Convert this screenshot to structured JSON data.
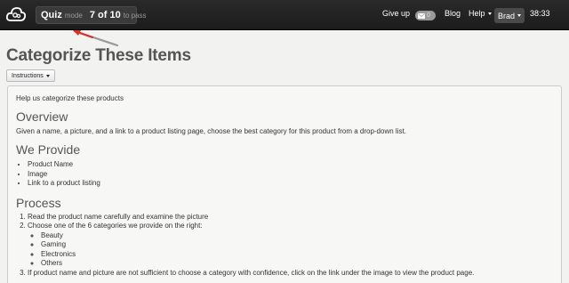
{
  "topbar": {
    "logo_icon": "cloud-logo-icon",
    "mode": {
      "quiz": "Quiz",
      "mode_word": "mode",
      "count": "7 of 10",
      "pass_text": "to pass"
    },
    "give_up": "Give up",
    "mail_icon": "envelope-icon",
    "mail_count": "0",
    "blog": "Blog",
    "help": "Help",
    "user": "Brad",
    "timer": "38:33"
  },
  "annotation": {
    "arrow_color": "#d9312b"
  },
  "main": {
    "title": "Categorize These Items",
    "instructions_button": "Instructions",
    "panel": {
      "intro": "Help us categorize these products",
      "overview_heading": "Overview",
      "overview_text": "Given a name, a picture, and a link to a product listing page, choose the best category for this product from a drop-down list.",
      "provide_heading": "We Provide",
      "provide_items": [
        "Product Name",
        "Image",
        "Link to a product listing"
      ],
      "process_heading": "Process",
      "process_steps": [
        "Read the product name carefully and examine the picture",
        "Choose one of the 6 categories we provide on the right:",
        "If product name and picture are not sufficient to choose a category with confidence, click on the link under the image to view the product page."
      ],
      "categories": [
        "Beauty",
        "Gaming",
        "Electronics",
        "Others"
      ]
    }
  }
}
